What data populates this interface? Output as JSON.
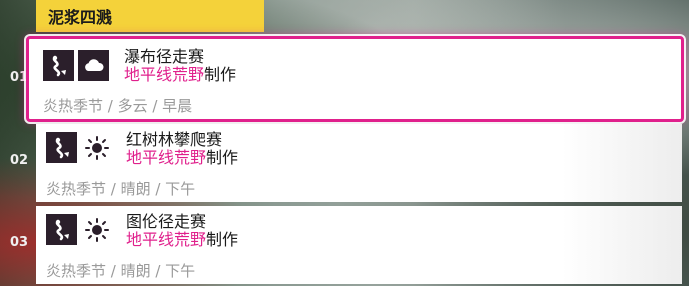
{
  "section": {
    "title": "泥浆四溅"
  },
  "rows": [
    {
      "number": "01",
      "title": "瀑布径走赛",
      "brand_highlight": "地平线荒野",
      "brand_suffix": "制作",
      "meta": "炎热季节 / 多云 / 早晨",
      "weather_icon": "cloud-icon",
      "route_icon": "trail-route-icon",
      "selected": true
    },
    {
      "number": "02",
      "title": "红树林攀爬赛",
      "brand_highlight": "地平线荒野",
      "brand_suffix": "制作",
      "meta": "炎热季节 / 晴朗 / 下午",
      "weather_icon": "sun-icon",
      "route_icon": "trail-route-icon",
      "selected": false
    },
    {
      "number": "03",
      "title": "图伦径走赛",
      "brand_highlight": "地平线荒野",
      "brand_suffix": "制作",
      "meta": "炎热季节 / 晴朗 / 下午",
      "weather_icon": "sun-icon",
      "route_icon": "trail-route-icon",
      "selected": false
    }
  ],
  "colors": {
    "accent": "#e0208c",
    "header": "#f4d23a",
    "icon_bg": "#2b1f2b"
  }
}
